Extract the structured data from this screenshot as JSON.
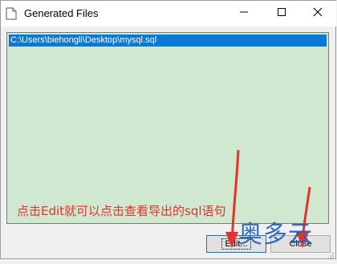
{
  "window": {
    "title": "Generated Files",
    "icon": "document-icon"
  },
  "titlebar_controls": {
    "minimize_icon": "minimize-icon",
    "maximize_icon": "maximize-icon",
    "close_icon": "close-icon"
  },
  "file_list": {
    "items": [
      "C:\\Users\\biehongli\\Desktop\\mysql.sql"
    ],
    "selected_index": 0,
    "background_color": "#cfe8cf",
    "selection_color": "#0a78d7"
  },
  "annotation": {
    "text": "点击Edit就可以点击查看导出的sql语句",
    "color": "#e4332c"
  },
  "buttons": {
    "edit_label": "Edit...",
    "close_label": "Close"
  },
  "watermark": {
    "text": "奥多云",
    "color": "#1f5fb8"
  }
}
